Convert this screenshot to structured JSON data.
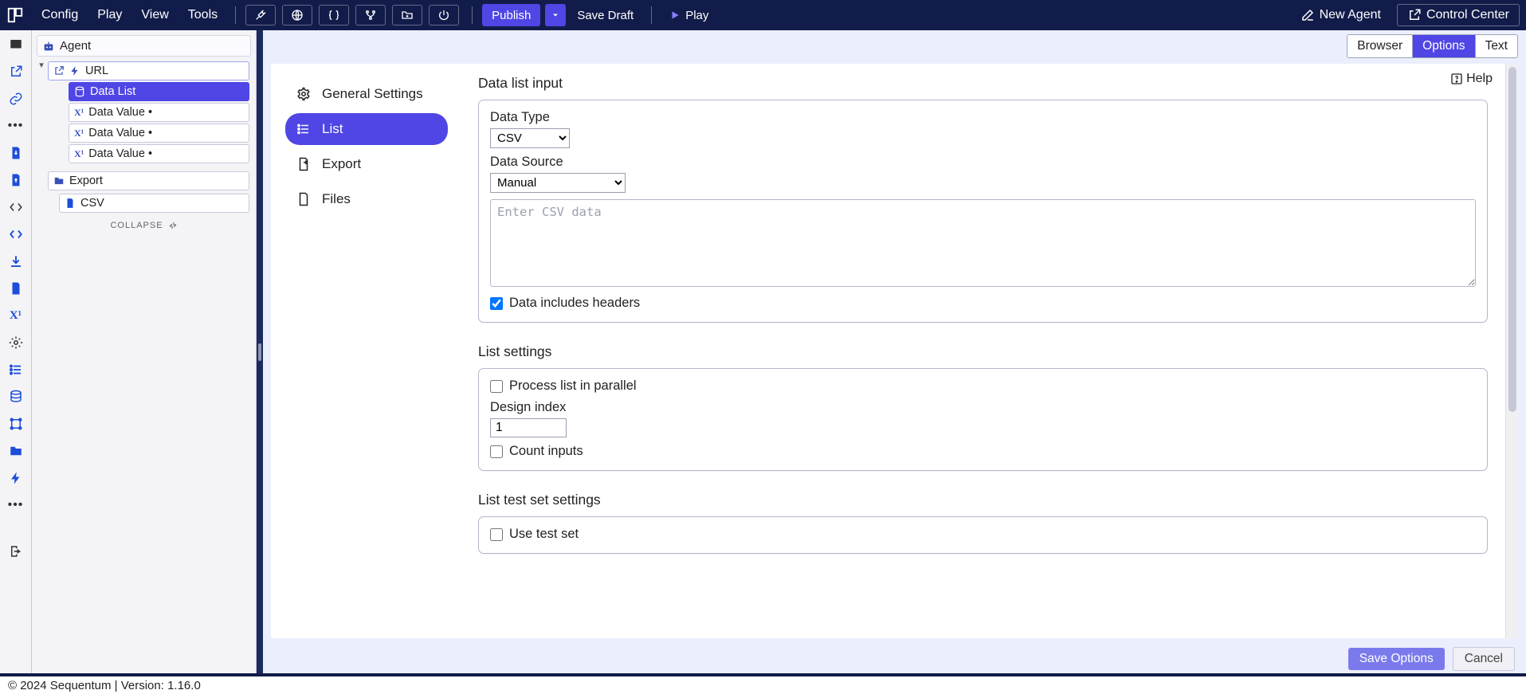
{
  "menubar": {
    "items": [
      "Config",
      "Play",
      "View",
      "Tools"
    ],
    "publish": "Publish",
    "save_draft": "Save Draft",
    "play": "Play",
    "new_agent": "New Agent",
    "control_center": "Control Center"
  },
  "tree": {
    "root": "Agent",
    "url_group": "URL",
    "data_list": "Data List",
    "data_value": "Data Value •",
    "export_group": "Export",
    "csv_leaf": "CSV",
    "collapse": "COLLAPSE"
  },
  "view_tabs": {
    "browser": "Browser",
    "options": "Options",
    "text": "Text"
  },
  "help": "Help",
  "nav": {
    "general": "General Settings",
    "list": "List",
    "export": "Export",
    "files": "Files"
  },
  "form": {
    "section_data_list_input": "Data list input",
    "data_type_label": "Data Type",
    "data_type_value": "CSV",
    "data_source_label": "Data Source",
    "data_source_value": "Manual",
    "csv_placeholder": "Enter CSV data",
    "data_includes_headers": "Data includes headers",
    "section_list_settings": "List settings",
    "process_parallel": "Process list in parallel",
    "design_index_label": "Design index",
    "design_index_value": "1",
    "count_inputs": "Count inputs",
    "section_test_set": "List test set settings",
    "use_test_set": "Use test set"
  },
  "actions": {
    "save": "Save Options",
    "cancel": "Cancel"
  },
  "status": "© 2024 Sequentum | Version: 1.16.0"
}
